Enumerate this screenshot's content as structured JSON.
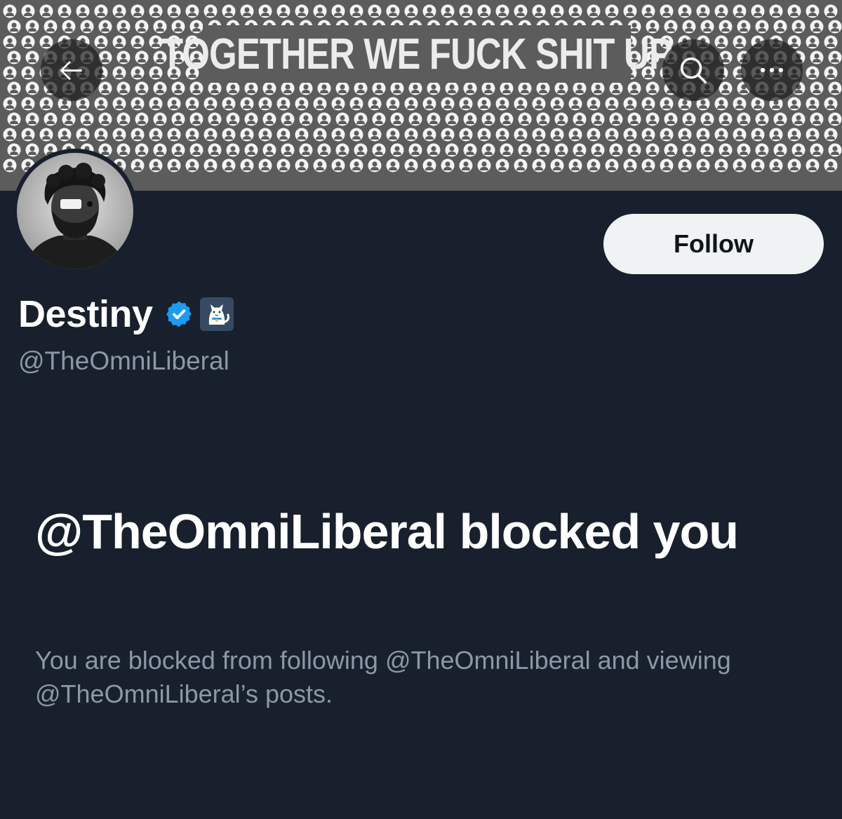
{
  "header": {
    "banner_slogan": "TOGETHER WE FUCK SHIT UP",
    "back_icon": "arrow-left-icon",
    "search_icon": "search-icon",
    "more_icon": "more-horizontal-icon"
  },
  "profile": {
    "display_name": "Destiny",
    "handle": "@TheOmniLiberal",
    "verified_badge_icon": "verified-badge-icon",
    "affiliate_badge_icon": "cat-affiliate-badge-icon",
    "follow_label": "Follow"
  },
  "blocked": {
    "title": "@TheOmniLiberal blocked you",
    "description": "You are blocked from following @TheOmniLiberal and viewing @TheOmniLiberal’s posts."
  },
  "colors": {
    "background": "#17202c",
    "banner": "#5c5c5c",
    "follow_button_bg": "#eff3f4",
    "muted_text": "#8b98a5",
    "verified_blue": "#1d9bf0"
  }
}
